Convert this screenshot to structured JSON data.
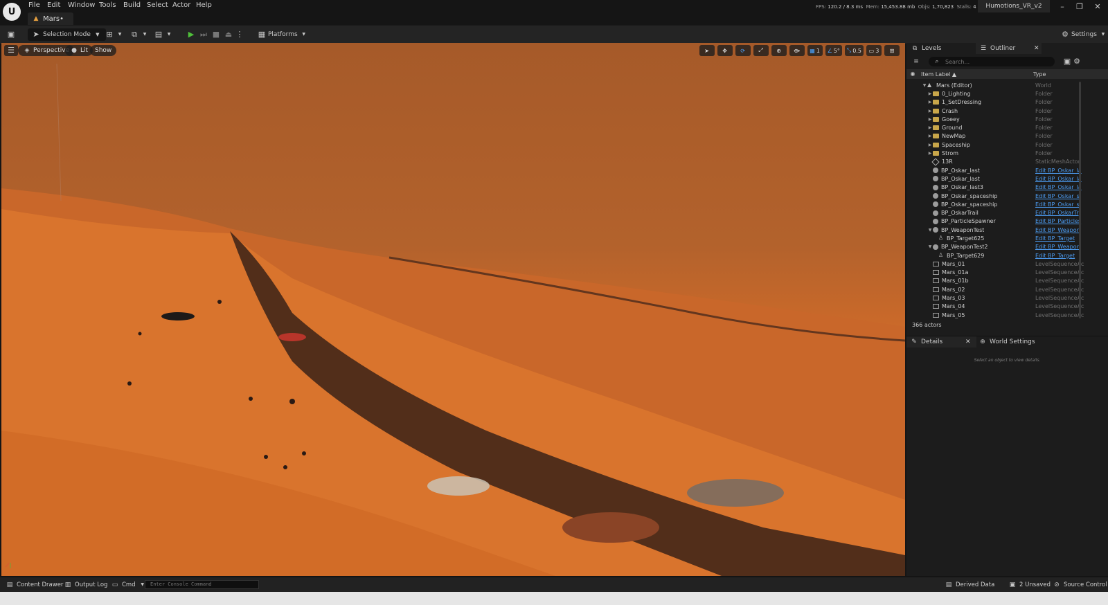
{
  "app": {
    "logo_text": "U",
    "menus": [
      "File",
      "Edit",
      "Window",
      "Tools",
      "Build",
      "Select",
      "Actor",
      "Help"
    ],
    "document_tab": "Mars•",
    "stats": {
      "fps_label": "FPS:",
      "fps": "120.2",
      "frame": "/ 8.3 ms",
      "mem_label": "Mem:",
      "mem": "15,453.88 mb",
      "objs_label": "Objs:",
      "objs": "1,70,823",
      "stalls_label": "Stalls:",
      "stalls": "4"
    },
    "project": "Humotions_VR_v2",
    "window_buttons": {
      "minimize": "–",
      "restore": "❐",
      "close": "✕"
    }
  },
  "toolbar": {
    "selection_mode": "Selection Mode",
    "platforms": "Platforms",
    "settings": "Settings"
  },
  "viewport": {
    "perspective": "Perspective",
    "lit": "Lit",
    "show": "Show",
    "grid_value": "1",
    "angle_value": "5°",
    "scale_value": "0.5",
    "camera_value": "3"
  },
  "panel": {
    "levels_tab": "Levels",
    "outliner_tab": "Outliner",
    "search_placeholder": "Search...",
    "col_label": "Item Label ▲",
    "col_type": "Type",
    "rows": [
      {
        "indent": 0,
        "arrow": "▼",
        "icon": "world",
        "label": "Mars (Editor)",
        "type": "World",
        "link": false
      },
      {
        "indent": 1,
        "arrow": "▶",
        "icon": "folder",
        "label": "0_Lighting",
        "type": "Folder",
        "link": false
      },
      {
        "indent": 1,
        "arrow": "▶",
        "icon": "folder",
        "label": "1_SetDressing",
        "type": "Folder",
        "link": false
      },
      {
        "indent": 1,
        "arrow": "▶",
        "icon": "folder",
        "label": "Crash",
        "type": "Folder",
        "link": false
      },
      {
        "indent": 1,
        "arrow": "▶",
        "icon": "folder",
        "label": "Goeey",
        "type": "Folder",
        "link": false
      },
      {
        "indent": 1,
        "arrow": "▶",
        "icon": "folder",
        "label": "Ground",
        "type": "Folder",
        "link": false
      },
      {
        "indent": 1,
        "arrow": "▶",
        "icon": "folder",
        "label": "NewMap",
        "type": "Folder",
        "link": false
      },
      {
        "indent": 1,
        "arrow": "▶",
        "icon": "folder",
        "label": "Spaceship",
        "type": "Folder",
        "link": false
      },
      {
        "indent": 1,
        "arrow": "▶",
        "icon": "folder",
        "label": "Strom",
        "type": "Folder",
        "link": false
      },
      {
        "indent": 1,
        "arrow": "",
        "icon": "mesh",
        "label": "13R",
        "type": "StaticMeshActor",
        "link": false
      },
      {
        "indent": 1,
        "arrow": "",
        "icon": "ball",
        "label": "BP_Oskar_last",
        "type": "Edit BP_Oskar_la",
        "link": true
      },
      {
        "indent": 1,
        "arrow": "",
        "icon": "ball",
        "label": "BP_Oskar_last",
        "type": "Edit BP_Oskar_la",
        "link": true
      },
      {
        "indent": 1,
        "arrow": "",
        "icon": "ball",
        "label": "BP_Oskar_last3",
        "type": "Edit BP_Oskar_la",
        "link": true
      },
      {
        "indent": 1,
        "arrow": "",
        "icon": "ball",
        "label": "BP_Oskar_spaceship",
        "type": "Edit BP_Oskar_s",
        "link": true
      },
      {
        "indent": 1,
        "arrow": "",
        "icon": "ball",
        "label": "BP_Oskar_spaceship",
        "type": "Edit BP_Oskar_s",
        "link": true
      },
      {
        "indent": 1,
        "arrow": "",
        "icon": "ball",
        "label": "BP_OskarTrail",
        "type": "Edit BP_OskarTr",
        "link": true
      },
      {
        "indent": 1,
        "arrow": "",
        "icon": "ball",
        "label": "BP_ParticleSpawner",
        "type": "Edit BP_Particles",
        "link": true
      },
      {
        "indent": 1,
        "arrow": "▼",
        "icon": "ball",
        "label": "BP_WeaponTest",
        "type": "Edit BP_Weapon",
        "link": true
      },
      {
        "indent": 2,
        "arrow": "",
        "icon": "pawn",
        "label": "BP_Target625",
        "type": "Edit BP_Target",
        "link": true
      },
      {
        "indent": 1,
        "arrow": "▼",
        "icon": "ball",
        "label": "BP_WeaponTest2",
        "type": "Edit BP_Weapon",
        "link": true
      },
      {
        "indent": 2,
        "arrow": "",
        "icon": "pawn",
        "label": "BP_Target629",
        "type": "Edit BP_Target",
        "link": true
      },
      {
        "indent": 1,
        "arrow": "",
        "icon": "seq",
        "label": "Mars_01",
        "type": "LevelSequenceAc",
        "link": false
      },
      {
        "indent": 1,
        "arrow": "",
        "icon": "seq",
        "label": "Mars_01a",
        "type": "LevelSequenceAc",
        "link": false
      },
      {
        "indent": 1,
        "arrow": "",
        "icon": "seq",
        "label": "Mars_01b",
        "type": "LevelSequenceAc",
        "link": false
      },
      {
        "indent": 1,
        "arrow": "",
        "icon": "seq",
        "label": "Mars_02",
        "type": "LevelSequenceAc",
        "link": false
      },
      {
        "indent": 1,
        "arrow": "",
        "icon": "seq",
        "label": "Mars_03",
        "type": "LevelSequenceAc",
        "link": false
      },
      {
        "indent": 1,
        "arrow": "",
        "icon": "seq",
        "label": "Mars_04",
        "type": "LevelSequenceAc",
        "link": false
      },
      {
        "indent": 1,
        "arrow": "",
        "icon": "seq",
        "label": "Mars_05",
        "type": "LevelSequenceAc",
        "link": false
      }
    ],
    "actor_count": "366 actors",
    "details_tab": "Details",
    "world_settings_tab": "World Settings",
    "details_empty": "Select an object to view details."
  },
  "bottom": {
    "content_drawer": "Content Drawer",
    "output_log": "Output Log",
    "cmd": "Cmd",
    "console_placeholder": "Enter Console Command",
    "derived_data": "Derived Data",
    "unsaved": "2 Unsaved",
    "source_control": "Source Control"
  },
  "colors": {
    "accent_blue": "#4c9bf0",
    "play_green": "#4fbf3a",
    "folder_yellow": "#c8a64a",
    "sky": "#a65a29",
    "sand": "#d8722b"
  }
}
